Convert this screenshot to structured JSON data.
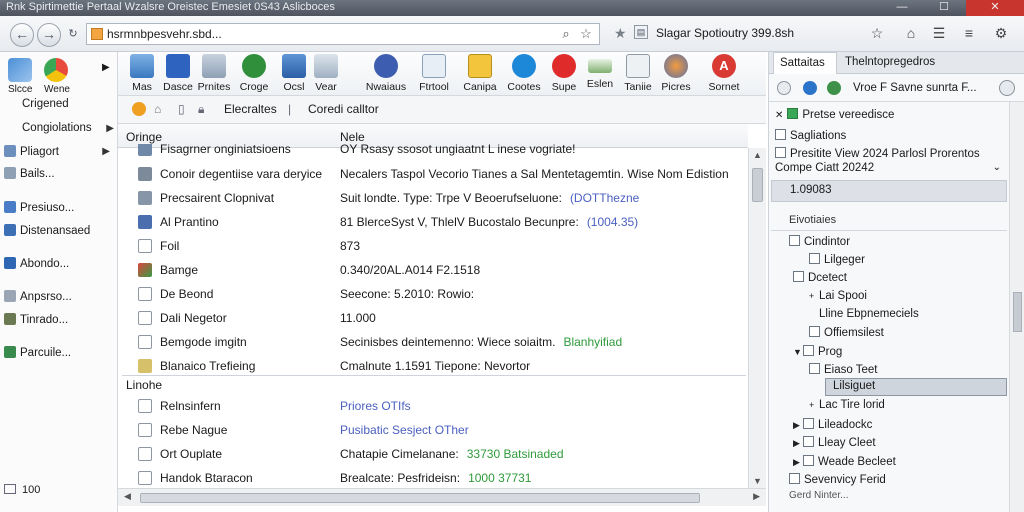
{
  "window": {
    "title": "Rnk Spirtimettie Pertaal Wzalsre Oreistec Emesiet 0S43 Aslicboces"
  },
  "address": {
    "url": "hsrmnbpesvehr.sbd..."
  },
  "search_panel": {
    "title": "Slagar Spotioutry 399.8sh"
  },
  "left": {
    "top_labels": [
      "Slcce",
      "Wene"
    ],
    "items": [
      {
        "label": "Crigened"
      },
      {
        "label": "Congiolations",
        "arrow": true
      },
      {
        "label": "Pliagort",
        "arrow": true
      },
      {
        "label": "Bails..."
      },
      {
        "label": "Presiuso..."
      },
      {
        "label": "Distenansaed"
      },
      {
        "label": "Abondo..."
      },
      {
        "label": "Anpsrso..."
      },
      {
        "label": "Tinrado..."
      },
      {
        "label": "Parcuile..."
      }
    ],
    "bottom": "100"
  },
  "toolbar": {
    "buttons": [
      "Mas",
      "Dasce",
      "Prnites",
      "Croge",
      "Ocsl",
      "Vear",
      "Nwaiaus",
      "Ftrtool",
      "Canipa",
      "Cootes",
      "Supe",
      "Eslen",
      "Taniie",
      "Picres",
      "Sornet"
    ],
    "row2_label1": "Elecraltes",
    "row2_label2": "Coredi calltor"
  },
  "list": {
    "col_name": "Oringe",
    "col_value": "Nele",
    "partial_row": {
      "name": "Fisagrner onginiatsioens",
      "value": "OY Rsasy ssosot ungiaatnt L  inese vogriate!"
    },
    "rows": [
      {
        "name": "Conoir degentiise vara deryice",
        "value": "Necalers Taspol Vecorio Tianes a Sal Mentetagemtin. Wise Nom Edistion",
        "tag": ""
      },
      {
        "name": "Precsairent Clopnivat",
        "value": "Suit londte. Type: Trpe V Beoerufseluone:",
        "tag": "(DOTThezne"
      },
      {
        "name": "Al Prantino",
        "value": "81 BlerceSyst V, ThlelV Bucostalo Becunpre:",
        "tag": "(1004.35)"
      },
      {
        "name": "Foil",
        "value": "873",
        "tag": ""
      },
      {
        "name": "Bamge",
        "value": "0.340/20AL.A014 F2.1518",
        "tag": ""
      },
      {
        "name": "De Beond",
        "value": "Seecone: 5.2010: Rowio:",
        "tag": ""
      },
      {
        "name": "Dali Negetor",
        "value": "11.000",
        "tag": ""
      },
      {
        "name": "Bemgode imgitn",
        "value": "Secinisbes deintemenno: Wiece soiaitm.",
        "tag": "Blanhyifiad"
      },
      {
        "name": "Blanaico Trefieing",
        "value": "Cmalnute 1.1591 Tiepone: Nevortor",
        "tag": ""
      }
    ],
    "section_label": "Linohe",
    "rows2": [
      {
        "name": "Relnsinfern",
        "value": "Priores OTIfs",
        "tag": ""
      },
      {
        "name": "Rebe Nague",
        "value": "Pusibatic Sesject OTher",
        "tag": ""
      },
      {
        "name": "Ort Ouplate",
        "value": "Chatapie Cimelanane:",
        "tag": "33730 Batsinaded"
      },
      {
        "name": "Handok Btaracon",
        "value": "Brealcate: Pesfrideisn:",
        "tag": "1000 37731"
      }
    ]
  },
  "right": {
    "tab1": "Sattaitas",
    "tab2": "Thelntopregedros",
    "subtitle": "Vroe F Savne sunrta F...",
    "items": [
      {
        "label": "Pretse vereedisce"
      },
      {
        "label": "Sagliations"
      },
      {
        "label": "Presitite View 2024 Parlosl Prorentos"
      },
      {
        "label": "Compe Ciatt 20242"
      }
    ],
    "selected": "1.09083",
    "section": "Eivotiaies",
    "tree": [
      {
        "label": "Cindintor",
        "exp": "",
        "indent": 0
      },
      {
        "label": "Lilgeger",
        "exp": "",
        "indent": 1
      },
      {
        "label": "Dcetect",
        "exp": "",
        "indent": 0
      },
      {
        "label": "Lai Spooi",
        "exp": "+",
        "indent": 1
      },
      {
        "label": "Lline Ebpnemeciels",
        "exp": "",
        "indent": 1
      },
      {
        "label": "Offiemsilest",
        "exp": "",
        "indent": 1
      },
      {
        "label": "Prog",
        "exp": "▼",
        "indent": 0
      },
      {
        "label": "Eiaso Teet",
        "exp": "",
        "indent": 1
      },
      {
        "label": "Lilsiguet",
        "exp": "",
        "indent": 2
      },
      {
        "label": "Lac Tire lorid",
        "exp": "+",
        "indent": 1
      },
      {
        "label": "Lileadockc",
        "exp": "▶",
        "indent": 1
      },
      {
        "label": "Lleay Cleet",
        "exp": "▶",
        "indent": 1
      },
      {
        "label": "Weade Becleet",
        "exp": "▶",
        "indent": 1
      },
      {
        "label": "Sevenvicy Ferid",
        "exp": "",
        "indent": 0
      }
    ],
    "footer": "Gerd Ninter..."
  }
}
